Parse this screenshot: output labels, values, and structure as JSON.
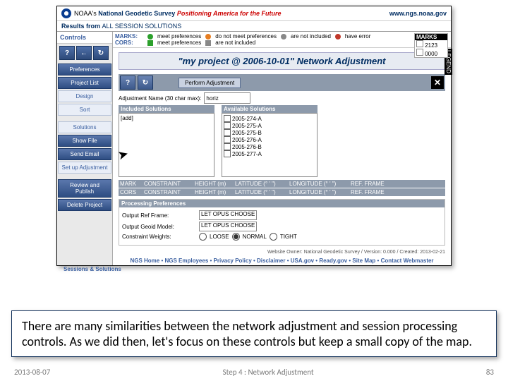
{
  "header": {
    "brand1": "NOAA's",
    "brand2": "National Geodetic Survey",
    "tagline": "Positioning America for the Future",
    "url": "www.ngs.noaa.gov"
  },
  "results": {
    "label": "Results from",
    "value": "ALL SESSION SOLUTIONS"
  },
  "controls": {
    "title": "Controls",
    "buttons": [
      "Preferences",
      "Project List",
      "Design",
      "Sort",
      "Solutions",
      "Show File",
      "Send Email",
      "Set up Adjustment",
      "Review and Publish",
      "Delete Project"
    ]
  },
  "legend": {
    "row1_label": "MARKS:",
    "row2_label": "CORS:",
    "i1": "meet preferences",
    "i2": "do not meet preferences",
    "i3": "are not included",
    "i4": "have error",
    "i5": "meet preferences",
    "i6": "are not included",
    "leg": "LEGEND"
  },
  "marks": {
    "h": "MARKS",
    "a": "2123",
    "b": "0000"
  },
  "title": "\"my project @ 2006-10-01\" Network Adjustment",
  "toolbar": {
    "perform": "Perform Adjustment"
  },
  "form": {
    "adjname_l": "Adjustment Name (30 char max):",
    "adjname_v": "horiz",
    "inc_h": "Included Solutions",
    "av_h": "Available Solutions",
    "add": "[add]",
    "avail": [
      "2005-274-A",
      "2005-275-A",
      "2005-275-B",
      "2005-276-A",
      "2005-276-B",
      "2005-277-A"
    ]
  },
  "cons": {
    "h1": [
      "MARK",
      "CONSTRAINT",
      "HEIGHT (m)",
      "LATITUDE (° ' \")",
      "LONGITUDE (° ' \")",
      "REF. FRAME"
    ],
    "h2": [
      "CORS",
      "CONSTRAINT",
      "HEIGHT (m)",
      "LATITUDE (° ' \")",
      "LONGITUDE (° ' \")",
      "REF. FRAME"
    ]
  },
  "prefs": {
    "h": "Processing Preferences",
    "l1": "Output Ref Frame:",
    "v1": "LET OPUS CHOOSE",
    "l2": "Output Geoid Model:",
    "v2": "LET OPUS CHOOSE",
    "l3": "Constraint Weights:",
    "r1": "LOOSE",
    "r2": "NORMAL",
    "r3": "TIGHT"
  },
  "footer": {
    "owner": "Website Owner: National Geodetic Survey / Version: 0.000 / Created: 2013-02-21",
    "links": "NGS Home • NGS Employees • Privacy Policy • Disclaimer • USA.gov • Ready.gov • Site Map • Contact Webmaster",
    "sessions": "Sessions & Solutions"
  },
  "caption": "There are many similarities between the network adjustment and session processing controls. As we did then, let's focus on these controls but keep a small copy of the map.",
  "slide": {
    "date": "2013-08-07",
    "step": "Step 4 : Network Adjustment",
    "num": "83"
  }
}
